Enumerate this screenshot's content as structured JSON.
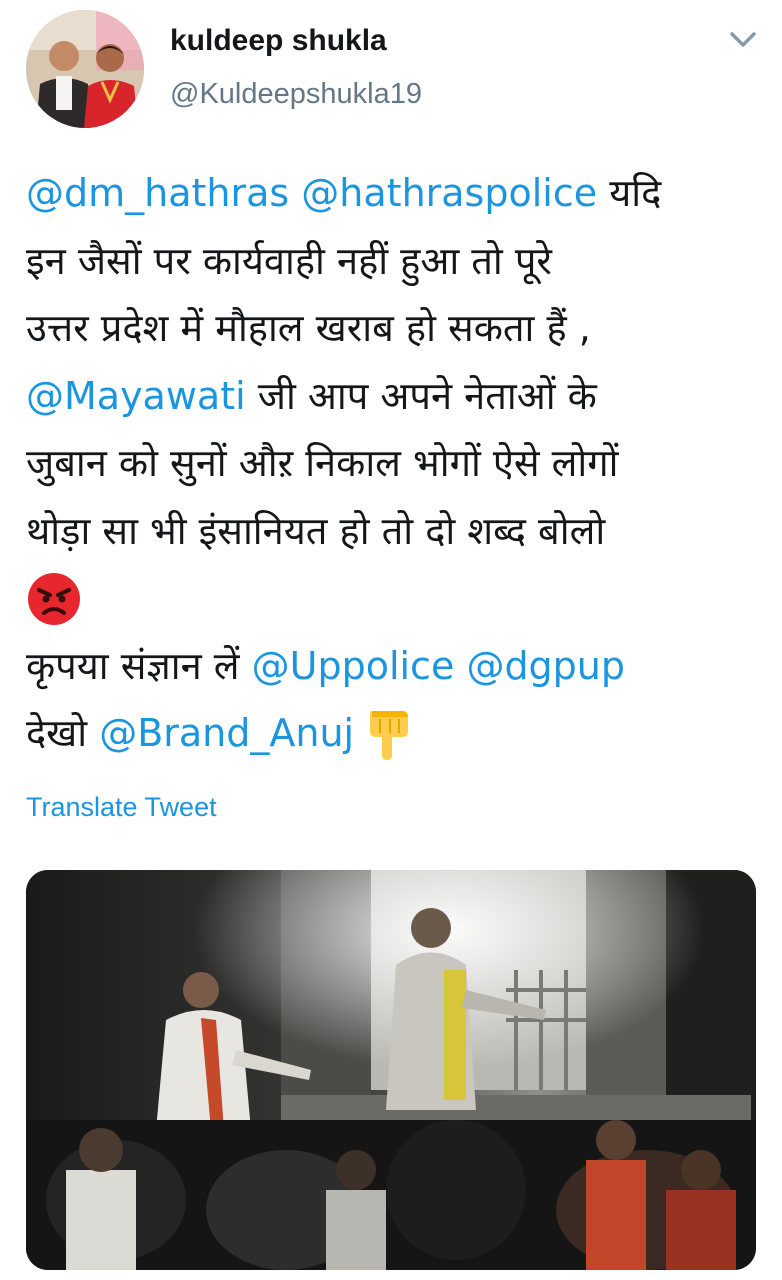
{
  "author": {
    "display_name": "kuldeep shukla",
    "handle": "@Kuldeepshukla19"
  },
  "header": {
    "menu_icon": "chevron-down-icon"
  },
  "tweet": {
    "lines": [
      [
        {
          "text": "@dm_hathras",
          "mention": true
        },
        {
          "text": " "
        },
        {
          "text": "@hathraspolice",
          "mention": true
        },
        {
          "text": " यदि"
        }
      ],
      [
        {
          "text": "इन जैसों पर कार्यवाही नहीं हुआ तो पूरे"
        }
      ],
      [
        {
          "text": "उत्तर प्रदेश में मौहाल खराब हो सकता हैं ,"
        }
      ],
      [
        {
          "text": "@Mayawati",
          "mention": true
        },
        {
          "text": " जी आप अपने नेताओं के"
        }
      ],
      [
        {
          "text": "जुबान को सुनों औऱ निकाल भोगों ऐसे लोगों"
        }
      ],
      [
        {
          "text": "थोड़ा सा भी इंसानियत हो तो दो शब्द बोलो"
        }
      ],
      [
        {
          "emoji": "angry-face-emoji"
        }
      ],
      [
        {
          "text": "कृपया संज्ञान लें "
        },
        {
          "text": "@Uppolice",
          "mention": true
        },
        {
          "text": " "
        },
        {
          "text": "@dgpup",
          "mention": true
        }
      ],
      [
        {
          "text": "देखो "
        },
        {
          "text": "@Brand_Anuj",
          "mention": true
        },
        {
          "emoji": "pointing-down-emoji"
        }
      ]
    ]
  },
  "translate_label": "Translate Tweet",
  "media": {
    "kind": "video-thumbnail"
  },
  "colors": {
    "link": "#1b95e0",
    "text": "#14171a",
    "secondary": "#657786"
  }
}
